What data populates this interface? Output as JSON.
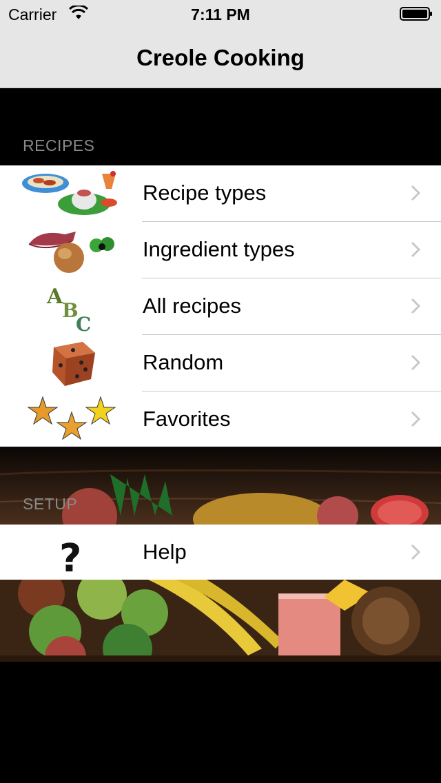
{
  "status_bar": {
    "carrier": "Carrier",
    "time": "7:11 PM",
    "wifi_icon": "wifi-icon",
    "battery_icon": "battery-icon"
  },
  "nav": {
    "title": "Creole Cooking"
  },
  "sections": {
    "recipes": {
      "header": "RECIPES",
      "items": [
        {
          "label": "Recipe types",
          "icon": "food-dishes-icon"
        },
        {
          "label": "Ingredient types",
          "icon": "ingredients-icon"
        },
        {
          "label": "All recipes",
          "icon": "abc-letters-icon"
        },
        {
          "label": "Random",
          "icon": "dice-icon"
        },
        {
          "label": "Favorites",
          "icon": "stars-icon"
        }
      ]
    },
    "setup": {
      "header": "SETUP",
      "items": [
        {
          "label": "Help",
          "icon": "question-mark-icon"
        }
      ]
    }
  },
  "colors": {
    "nav_background": "#e6e6e6",
    "header_text": "#8a8a8a",
    "chevron": "#c7c7cc",
    "separator": "#c8c7cc",
    "page_background": "#000000"
  },
  "banners": {
    "top": "tropical-fruit-banner",
    "bottom": "fruit-juice-banner"
  }
}
